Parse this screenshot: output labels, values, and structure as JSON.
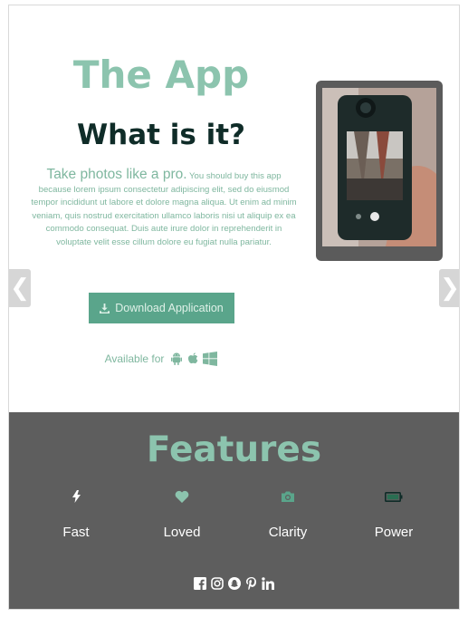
{
  "hero": {
    "app_title": "The App",
    "subtitle": "What is it?",
    "lead": "Take photos like a pro.",
    "description": "You should buy this app because lorem ipsum consectetur adipiscing elit, sed do eiusmod tempor incididunt ut labore et dolore magna aliqua. Ut enim ad minim veniam, quis nostrud exercitation ullamco laboris nisi ut aliquip ex ea commodo consequat. Duis aute irure dolor in reprehenderit in voluptate velit esse cillum dolore eu fugiat nulla pariatur.",
    "download_label": "Download Application",
    "available_label": "Available for",
    "platform_icons": [
      "android-icon",
      "apple-icon",
      "windows-icon"
    ]
  },
  "carousel": {
    "prev": "❮",
    "next": "❯"
  },
  "features": {
    "title": "Features",
    "items": [
      {
        "icon": "bolt-icon",
        "label": "Fast"
      },
      {
        "icon": "heart-icon",
        "label": "Loved"
      },
      {
        "icon": "camera-icon",
        "label": "Clarity"
      },
      {
        "icon": "battery-icon",
        "label": "Power"
      }
    ]
  },
  "social": [
    "facebook-icon",
    "instagram-icon",
    "snapchat-icon",
    "pinterest-icon",
    "linkedin-icon"
  ],
  "colors": {
    "accent": "#8cc4ae",
    "heading_dark": "#0f2c28",
    "button": "#5aa58b",
    "features_bg": "#5e5e5e",
    "feature_icon": "#8cc4ae"
  }
}
